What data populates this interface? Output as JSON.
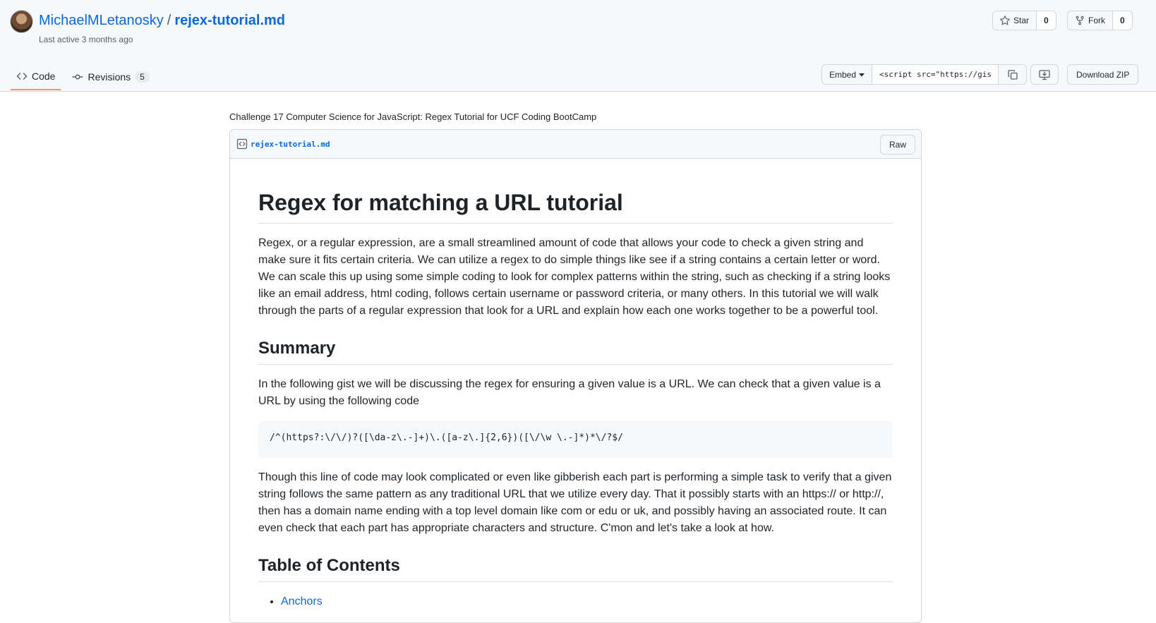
{
  "header": {
    "owner": "MichaelMLetanosky",
    "separator": "/",
    "filename": "rejex-tutorial.md",
    "last_active": "Last active 3 months ago",
    "star": {
      "label": "Star",
      "count": "0"
    },
    "fork": {
      "label": "Fork",
      "count": "0"
    }
  },
  "tabs": [
    {
      "label": "Code"
    },
    {
      "label": "Revisions",
      "count": "5"
    }
  ],
  "toolbar": {
    "embed_label": "Embed",
    "embed_value": "<script src=\"https://gis",
    "download_label": "Download ZIP"
  },
  "gist": {
    "description": "Challenge 17 Computer Science for JavaScript: Regex Tutorial for UCF Coding BootCamp",
    "file_name": "rejex-tutorial.md",
    "raw_label": "Raw"
  },
  "content": {
    "h1": "Regex for matching a URL tutorial",
    "intro": "Regex, or a regular expression, are a small streamlined amount of code that allows your code to check a given string and make sure it fits certain criteria. We can utilize a regex to do simple things like see if a string contains a certain letter or word. We can scale this up using some simple coding to look for complex patterns within the string, such as checking if a string looks like an email address, html coding, follows certain username or password criteria, or many others. In this tutorial we will walk through the parts of a regular expression that look for a URL and explain how each one works together to be a powerful tool.",
    "summary_heading": "Summary",
    "summary_text": "In the following gist we will be discussing the regex for ensuring a given value is a URL. We can check that a given value is a URL by using the following code",
    "code": "/^(https?:\\/\\/)?([\\da-z\\.-]+)\\.([a-z\\.]{2,6})([\\/\\w \\.-]*)*\\/?$/",
    "explain": "Though this line of code may look complicated or even like gibberish each part is performing a simple task to verify that a given string follows the same pattern as any traditional URL that we utilize every day. That it possibly starts with an https:// or http://, then has a domain name ending with a top level domain like com or edu or uk, and possibly having an associated route. It can even check that each part has appropriate characters and structure. C'mon and let's take a look at how.",
    "toc_heading": "Table of Contents",
    "toc_items": [
      "Anchors"
    ]
  }
}
